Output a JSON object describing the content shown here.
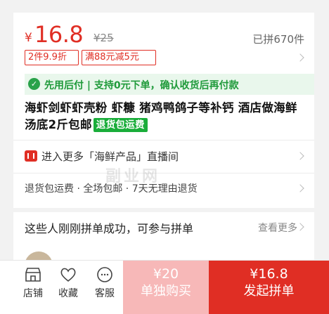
{
  "price": {
    "currency": "¥",
    "value": "16.8",
    "original": "¥25",
    "sold": "已拼670件"
  },
  "promo_tags": [
    "2件9.9折",
    "满88元减5元"
  ],
  "pay_later": {
    "icon": "check-shield-icon",
    "text": "先用后付 | 支持0元下单，确认收货后再付款"
  },
  "product": {
    "title": "海虾剑虾虾壳粉 虾糠 猪鸡鸭鸽子等补钙 酒店做海鲜汤底2斤包邮",
    "badge": "退货包运费"
  },
  "live": {
    "icon": "live-stream-icon",
    "text": "进入更多「海鲜产品」直播间"
  },
  "service": {
    "text": "退货包运费 · 全场包邮 · 7天无理由退货"
  },
  "group": {
    "title": "这些人刚刚拼单成功，可参与拼单",
    "more": "查看更多"
  },
  "bottom_nav": [
    {
      "label": "店铺",
      "icon": "store-icon"
    },
    {
      "label": "收藏",
      "icon": "heart-icon"
    },
    {
      "label": "客服",
      "icon": "chat-icon"
    }
  ],
  "buy_single": {
    "price": "¥20",
    "label": "单独购买"
  },
  "buy_group": {
    "price": "¥16.8",
    "label": "发起拼单"
  },
  "colors": {
    "brand_red": "#e02e24",
    "green": "#1aad3a",
    "pale_red": "#f7b8b8"
  },
  "watermark": "副业网"
}
